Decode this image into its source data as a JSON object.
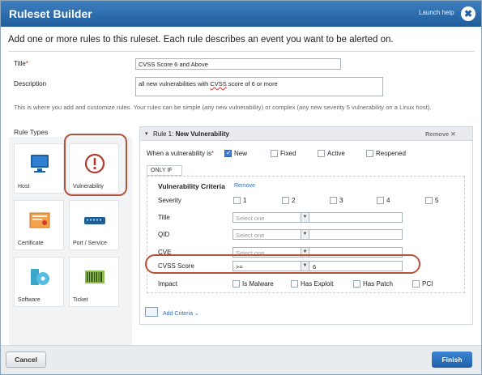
{
  "dialog": {
    "title": "Ruleset Builder",
    "launch_help": "Launch help",
    "close_glyph": "✖"
  },
  "intro": "Add one or more rules to this ruleset. Each rule describes an event you want to be alerted on.",
  "form": {
    "title_label": "Title",
    "title_required": "*",
    "title_value": "CVSS Score 6 and Above",
    "description_label": "Description",
    "description_value_pre": "all new vulnerabilities with ",
    "description_value_flag": "CVSS",
    "description_value_post": " score of 6 or more"
  },
  "hint": "This is where you add and customize rules. Your rules can be simple (any new vulnerability) or complex (any new severity 5 vulnerability on a Linux host).",
  "rule_types": {
    "heading": "Rule Types",
    "items": [
      {
        "label": "Host",
        "icon": "monitor-icon"
      },
      {
        "label": "Vulnerability",
        "icon": "alert-circle-icon",
        "selected": true
      },
      {
        "label": "Certificate",
        "icon": "certificate-icon"
      },
      {
        "label": "Port / Service",
        "icon": "network-switch-icon"
      },
      {
        "label": "Software",
        "icon": "software-disc-icon"
      },
      {
        "label": "Ticket",
        "icon": "barcode-ticket-icon"
      }
    ]
  },
  "rule": {
    "caret": "▾",
    "title_prefix": "Rule 1: ",
    "title_bold": "New Vulnerability",
    "remove": "Remove ✕",
    "when_label": "When a vulnerability is",
    "when_required": "*",
    "states": [
      {
        "label": "New",
        "checked": true
      },
      {
        "label": "Fixed",
        "checked": false
      },
      {
        "label": "Active",
        "checked": false
      },
      {
        "label": "Reopened",
        "checked": false
      }
    ],
    "only_if": "ONLY IF",
    "criteria_title": "Vulnerability Criteria",
    "criteria_remove": "Remove",
    "severity_label": "Severity",
    "severity_options": [
      "1",
      "2",
      "3",
      "4",
      "5"
    ],
    "title_label": "Title",
    "qid_label": "QID",
    "cve_label": "CVE",
    "select_placeholder": "Select one",
    "cvss_label": "CVSS Score",
    "cvss_operator": ">=",
    "cvss_value": "6",
    "impact_label": "Impact",
    "impact_options": [
      "Is Malware",
      "Has Exploit",
      "Has Patch",
      "PCI"
    ],
    "add_criteria": "Add Criteria ⌄"
  },
  "footer": {
    "cancel": "Cancel",
    "finish": "Finish"
  },
  "colors": {
    "brand_blue": "#1f5d9c",
    "highlight_oval": "#b5523b",
    "link_blue": "#2f6fbf"
  }
}
